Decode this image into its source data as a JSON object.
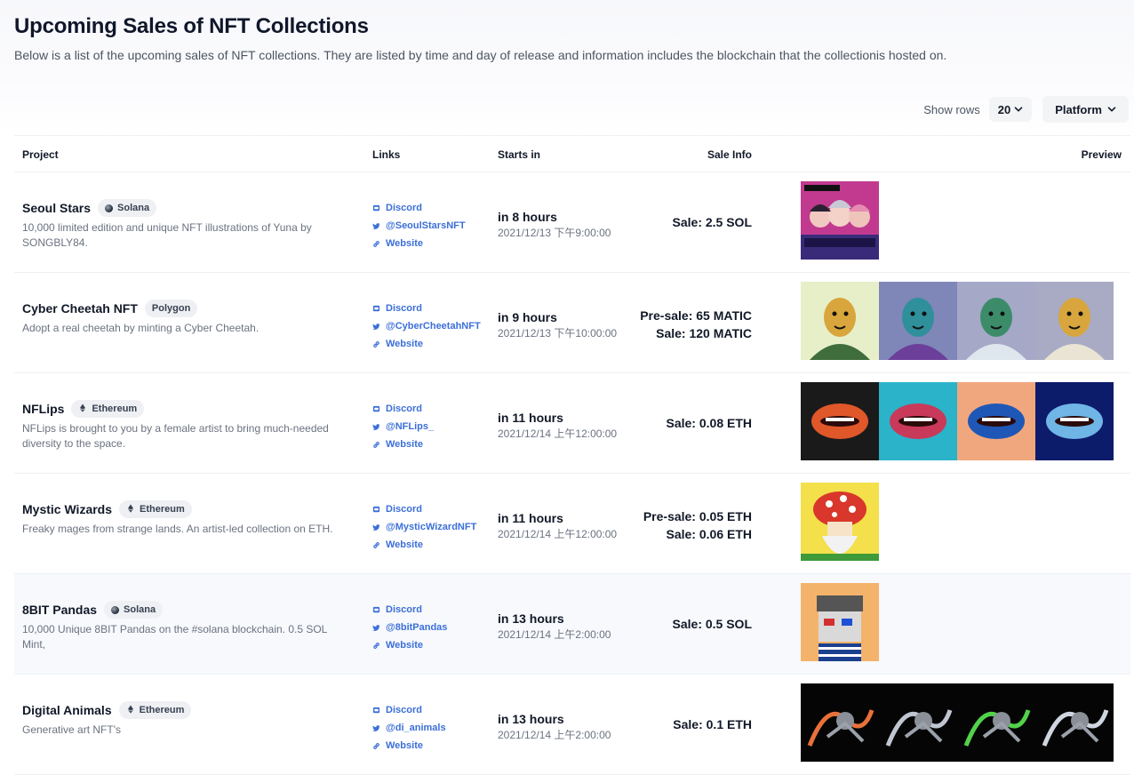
{
  "header": {
    "title": "Upcoming Sales of NFT Collections",
    "subtitle": "Below is a list of the upcoming sales of NFT collections. They are listed by time and day of release and information includes the blockchain that the collectionis hosted on."
  },
  "controls": {
    "show_rows_label": "Show rows",
    "rows_value": "20",
    "platform_label": "Platform"
  },
  "table": {
    "columns": {
      "project": "Project",
      "links": "Links",
      "starts": "Starts in",
      "sale": "Sale Info",
      "preview": "Preview"
    },
    "rows": [
      {
        "name": "Seoul Stars",
        "chain": "Solana",
        "chain_icon": "solana-icon",
        "desc": "10,000 limited edition and unique NFT illustrations of Yuna by SONGBLY84.",
        "discord": "Discord",
        "twitter": "@SeoulStarsNFT",
        "website": "Website",
        "starts_rel": "in 8 hours",
        "starts_abs": "2021/12/13 下午9:00:00",
        "sale": [
          "Sale: 2.5 SOL"
        ],
        "preview_count": 1
      },
      {
        "name": "Cyber Cheetah NFT",
        "chain": "Polygon",
        "chain_icon": "",
        "desc": "Adopt a real cheetah by minting a Cyber Cheetah.",
        "discord": "Discord",
        "twitter": "@CyberCheetahNFT",
        "website": "Website",
        "starts_rel": "in 9 hours",
        "starts_abs": "2021/12/13 下午10:00:00",
        "sale": [
          "Pre-sale: 65 MATIC",
          "Sale: 120 MATIC"
        ],
        "preview_count": 4
      },
      {
        "name": "NFLips",
        "chain": "Ethereum",
        "chain_icon": "ethereum-icon",
        "desc": "NFLips is brought to you by a female artist to bring much-needed diversity to the space.",
        "discord": "Discord",
        "twitter": "@NFLips_",
        "website": "Website",
        "starts_rel": "in 11 hours",
        "starts_abs": "2021/12/14 上午12:00:00",
        "sale": [
          "Sale: 0.08 ETH"
        ],
        "preview_count": 4
      },
      {
        "name": "Mystic Wizards",
        "chain": "Ethereum",
        "chain_icon": "ethereum-icon",
        "desc": "Freaky mages from strange lands. An artist-led collection on ETH.",
        "discord": "Discord",
        "twitter": "@MysticWizardNFT",
        "website": "Website",
        "starts_rel": "in 11 hours",
        "starts_abs": "2021/12/14 上午12:00:00",
        "sale": [
          "Pre-sale: 0.05 ETH",
          "Sale: 0.06 ETH"
        ],
        "preview_count": 1
      },
      {
        "name": "8BIT Pandas",
        "chain": "Solana",
        "chain_icon": "solana-icon",
        "desc": "10,000 Unique 8BIT Pandas on the #solana blockchain. 0.5 SOL Mint,",
        "discord": "Discord",
        "twitter": "@8bitPandas",
        "website": "Website",
        "starts_rel": "in 13 hours",
        "starts_abs": "2021/12/14 上午2:00:00",
        "sale": [
          "Sale: 0.5 SOL"
        ],
        "preview_count": 1
      },
      {
        "name": "Digital Animals",
        "chain": "Ethereum",
        "chain_icon": "ethereum-icon",
        "desc": "Generative art NFT's",
        "discord": "Discord",
        "twitter": "@di_animals",
        "website": "Website",
        "starts_rel": "in 13 hours",
        "starts_abs": "2021/12/14 上午2:00:00",
        "sale": [
          "Sale: 0.1 ETH"
        ],
        "preview_count": 4
      }
    ]
  },
  "colors": {
    "link": "#3b6fd8",
    "chip_bg": "#eef0f3",
    "hover_row": "#f7f9fc"
  }
}
